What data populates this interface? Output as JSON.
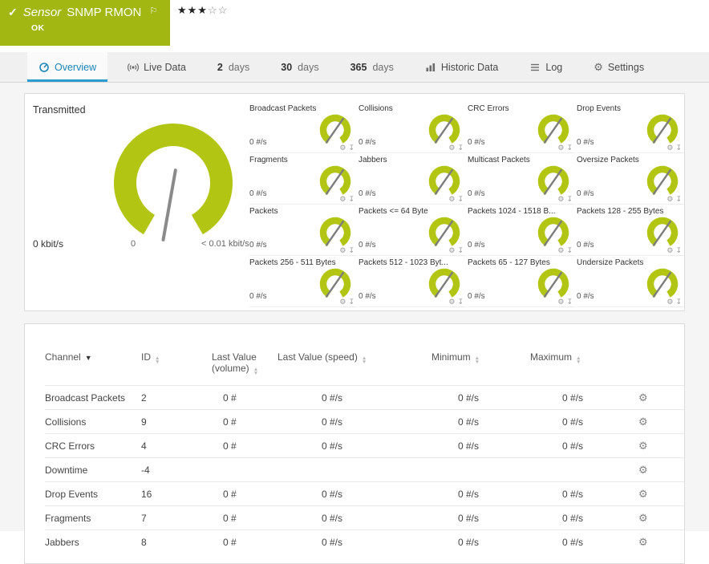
{
  "colors": {
    "status_green": "#a2b712",
    "gauge_green": "#b2c513",
    "accent_blue": "#1d86b8",
    "tab_underline": "#2d9cce"
  },
  "header": {
    "kind": "Sensor",
    "name": "SNMP RMON",
    "status": "OK",
    "stars_filled": "★★★",
    "stars_empty": "☆☆"
  },
  "tabs": [
    {
      "label": "Overview"
    },
    {
      "label": "Live Data"
    },
    {
      "num": "2",
      "label": "days"
    },
    {
      "num": "30",
      "label": "days"
    },
    {
      "num": "365",
      "label": "days"
    },
    {
      "label": "Historic Data"
    },
    {
      "label": "Log"
    },
    {
      "label": "Settings"
    }
  ],
  "transmitted": {
    "title": "Transmitted",
    "value": "0 kbit/s",
    "scale_min": "0",
    "scale_max": "< 0.01 kbit/s"
  },
  "mini_gauges": [
    {
      "title": "Broadcast Packets",
      "value": "0 #/s"
    },
    {
      "title": "Collisions",
      "value": "0 #/s"
    },
    {
      "title": "CRC Errors",
      "value": "0 #/s"
    },
    {
      "title": "Drop Events",
      "value": "0 #/s"
    },
    {
      "title": "Fragments",
      "value": "0 #/s"
    },
    {
      "title": "Jabbers",
      "value": "0 #/s"
    },
    {
      "title": "Multicast Packets",
      "value": "0 #/s"
    },
    {
      "title": "Oversize Packets",
      "value": "0 #/s"
    },
    {
      "title": "Packets",
      "value": "0 #/s"
    },
    {
      "title": "Packets <= 64 Byte",
      "value": "0 #/s"
    },
    {
      "title": "Packets 1024 - 1518 B...",
      "value": "0 #/s"
    },
    {
      "title": "Packets 128 - 255 Bytes",
      "value": "0 #/s"
    },
    {
      "title": "Packets 256 - 511 Bytes",
      "value": "0 #/s"
    },
    {
      "title": "Packets 512 - 1023 Byt...",
      "value": "0 #/s"
    },
    {
      "title": "Packets 65 - 127 Bytes",
      "value": "0 #/s"
    },
    {
      "title": "Undersize Packets",
      "value": "0 #/s"
    }
  ],
  "table": {
    "headers": {
      "channel": "Channel",
      "id": "ID",
      "last_value_volume": "Last Value (volume)",
      "last_value_speed": "Last Value (speed)",
      "minimum": "Minimum",
      "maximum": "Maximum"
    },
    "rows": [
      {
        "channel": "Broadcast Packets",
        "id": "2",
        "volume": "0 #",
        "speed": "0 #/s",
        "min": "0 #/s",
        "max": "0 #/s"
      },
      {
        "channel": "Collisions",
        "id": "9",
        "volume": "0 #",
        "speed": "0 #/s",
        "min": "0 #/s",
        "max": "0 #/s"
      },
      {
        "channel": "CRC Errors",
        "id": "4",
        "volume": "0 #",
        "speed": "0 #/s",
        "min": "0 #/s",
        "max": "0 #/s"
      },
      {
        "channel": "Downtime",
        "id": "-4",
        "volume": "",
        "speed": "",
        "min": "",
        "max": ""
      },
      {
        "channel": "Drop Events",
        "id": "16",
        "volume": "0 #",
        "speed": "0 #/s",
        "min": "0 #/s",
        "max": "0 #/s"
      },
      {
        "channel": "Fragments",
        "id": "7",
        "volume": "0 #",
        "speed": "0 #/s",
        "min": "0 #/s",
        "max": "0 #/s"
      },
      {
        "channel": "Jabbers",
        "id": "8",
        "volume": "0 #",
        "speed": "0 #/s",
        "min": "0 #/s",
        "max": "0 #/s"
      }
    ]
  }
}
